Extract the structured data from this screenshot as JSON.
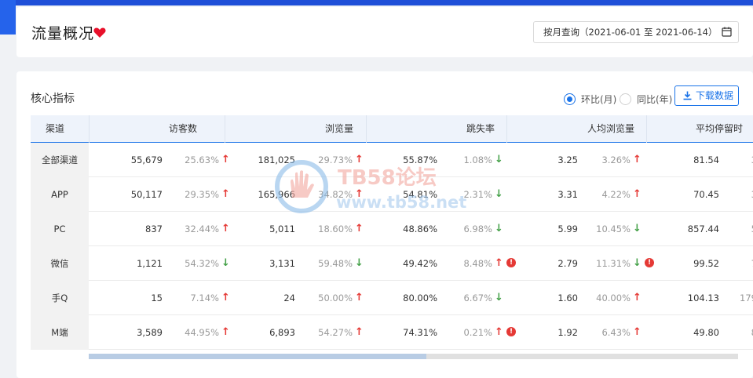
{
  "header": {
    "title": "流量概况",
    "date_range": "按月查询（2021-06-01 至 2021-06-14）"
  },
  "section": {
    "title": "核心指标"
  },
  "compare": {
    "options": [
      {
        "label": "环比(月)",
        "selected": true
      },
      {
        "label": "同比(年)",
        "selected": false
      }
    ]
  },
  "download_label": "下载数据",
  "columns": {
    "channel": "渠道",
    "visitors": "访客数",
    "pageviews": "浏览量",
    "bounce": "跳失率",
    "avg_pv": "人均浏览量",
    "avg_stay": "平均停留时"
  },
  "rows": [
    {
      "channel": "全部渠道",
      "visitors": "55,679",
      "visitors_pct": "25.63%",
      "visitors_dir": "up",
      "pv": "181,025",
      "pv_pct": "29.73%",
      "pv_dir": "up",
      "bounce": "55.87%",
      "bounce_pct": "1.08%",
      "bounce_dir": "down",
      "bounce_warn": false,
      "avgpv": "3.25",
      "avgpv_pct": "3.26%",
      "avgpv_dir": "up",
      "avgpv_warn": false,
      "stay": "81.54",
      "stay_pct": "3"
    },
    {
      "channel": "APP",
      "visitors": "50,117",
      "visitors_pct": "29.35%",
      "visitors_dir": "up",
      "pv": "165,966",
      "pv_pct": "34.82%",
      "pv_dir": "up",
      "bounce": "54.81%",
      "bounce_pct": "2.31%",
      "bounce_dir": "down",
      "bounce_warn": false,
      "avgpv": "3.31",
      "avgpv_pct": "4.22%",
      "avgpv_dir": "up",
      "avgpv_warn": false,
      "stay": "70.45",
      "stay_pct": "3"
    },
    {
      "channel": "PC",
      "visitors": "837",
      "visitors_pct": "32.44%",
      "visitors_dir": "up",
      "pv": "5,011",
      "pv_pct": "18.60%",
      "pv_dir": "up",
      "bounce": "48.86%",
      "bounce_pct": "6.98%",
      "bounce_dir": "down",
      "bounce_warn": false,
      "avgpv": "5.99",
      "avgpv_pct": "10.45%",
      "avgpv_dir": "down",
      "avgpv_warn": false,
      "stay": "857.44",
      "stay_pct": "5"
    },
    {
      "channel": "微信",
      "visitors": "1,121",
      "visitors_pct": "54.32%",
      "visitors_dir": "down",
      "pv": "3,131",
      "pv_pct": "59.48%",
      "pv_dir": "down",
      "bounce": "49.42%",
      "bounce_pct": "8.48%",
      "bounce_dir": "up",
      "bounce_warn": true,
      "avgpv": "2.79",
      "avgpv_pct": "11.31%",
      "avgpv_dir": "down",
      "avgpv_warn": true,
      "stay": "99.52",
      "stay_pct": "7"
    },
    {
      "channel": "手Q",
      "visitors": "15",
      "visitors_pct": "7.14%",
      "visitors_dir": "up",
      "pv": "24",
      "pv_pct": "50.00%",
      "pv_dir": "up",
      "bounce": "80.00%",
      "bounce_pct": "6.67%",
      "bounce_dir": "down",
      "bounce_warn": false,
      "avgpv": "1.60",
      "avgpv_pct": "40.00%",
      "avgpv_dir": "up",
      "avgpv_warn": false,
      "stay": "104.13",
      "stay_pct": "179"
    },
    {
      "channel": "M端",
      "visitors": "3,589",
      "visitors_pct": "44.95%",
      "visitors_dir": "up",
      "pv": "6,893",
      "pv_pct": "54.27%",
      "pv_dir": "up",
      "bounce": "74.31%",
      "bounce_pct": "0.21%",
      "bounce_dir": "up",
      "bounce_warn": true,
      "avgpv": "1.92",
      "avgpv_pct": "6.43%",
      "avgpv_dir": "up",
      "avgpv_warn": false,
      "stay": "49.80",
      "stay_pct": "8"
    }
  ],
  "scroll_position": 0.52,
  "watermark": {
    "title": "TB58论坛",
    "url": "www.tb58.net"
  },
  "colors": {
    "accent": "#1a73e8",
    "up": "#e53935",
    "down": "#43a047",
    "header_bar": "#1f4fd8"
  }
}
